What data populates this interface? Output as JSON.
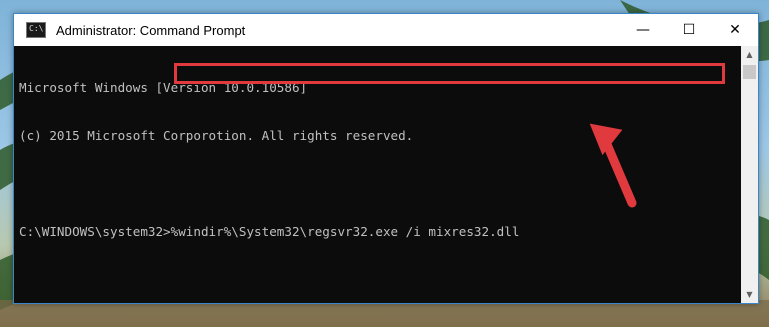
{
  "window": {
    "title": "Administrator: Command Prompt",
    "app_icon_text": "C:\\"
  },
  "controls": {
    "minimize": "—",
    "maximize": "☐",
    "close": "✕"
  },
  "console": {
    "lines": [
      "Microsoft Windows [Version 10.0.10586]",
      "(c) 2015 Microsoft Corporotion. All rights reserved.",
      "",
      "C:\\WINDOWS\\system32>%windir%\\System32\\regsvr32.exe /i mixres32.dll"
    ]
  },
  "colors": {
    "highlight": "#e0393e",
    "console_bg": "#0c0c0c",
    "console_text": "#c0c0c0"
  },
  "icons": {
    "scroll_up": "triangle-up-icon",
    "scroll_down": "triangle-down-icon"
  }
}
